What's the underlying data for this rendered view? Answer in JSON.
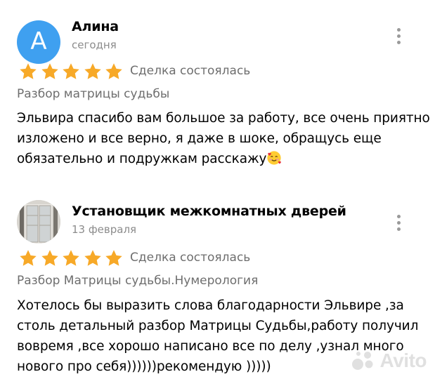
{
  "colors": {
    "star": "#f7a928",
    "avatar_alina": "#3fa0f0",
    "secondary_text": "#6e6e6e",
    "date_text": "#8c8c8c"
  },
  "reviews": [
    {
      "avatar_letter": "А",
      "author": "Алина",
      "date": "сегодня",
      "rating": 5,
      "deal_status": "Сделка состоялась",
      "service": "Разбор матрицы судьбы",
      "text_lines": [
        "Эльвира спасибо вам большое за работу, все очень приятно",
        "изложено и все верно, я даже в шоке, обращусь еще",
        "обязательно и подружкам расскажу"
      ],
      "emoji": "smiling-face-with-hearts-emoji"
    },
    {
      "author": "Установщик межкомнатных дверей",
      "date": "13 февраля",
      "rating": 5,
      "deal_status": "Сделка состоялась",
      "service": "Разбор Матрицы судьбы.Нумерология",
      "text_lines": [
        "Хотелось бы выразить слова благодарности Эльвире ,за",
        "столь детальный разбор Матрицы Судьбы,работу получил",
        "вовремя ,все хорошо  написано все по делу ,узнал много",
        "нового про себя))))))рекомендую )))))"
      ]
    }
  ],
  "watermark": {
    "text": "Avito"
  }
}
